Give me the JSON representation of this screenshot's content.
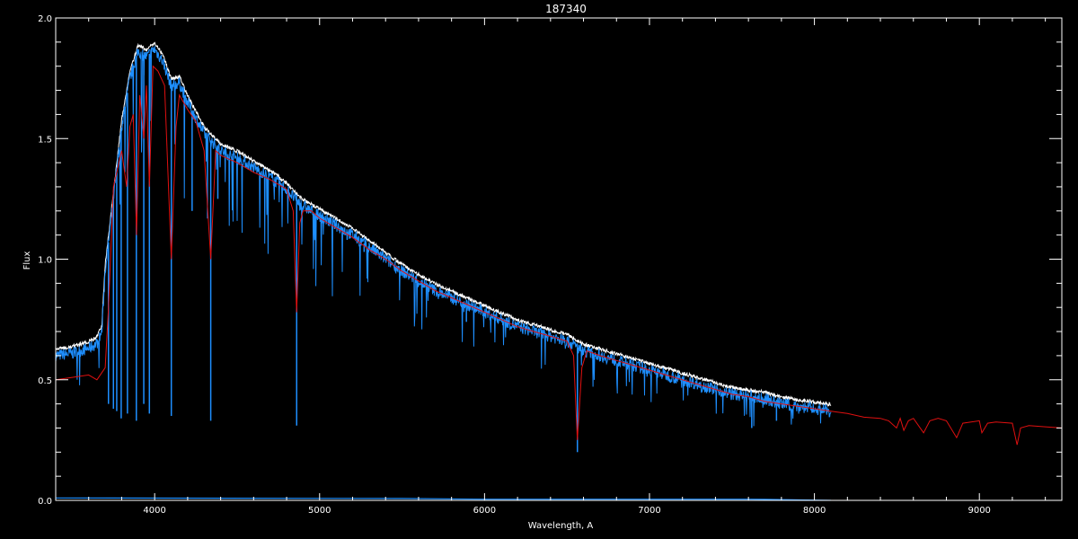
{
  "chart_data": {
    "type": "line",
    "title": "187340",
    "xlabel": "Wavelength, A",
    "ylabel": "Flux",
    "xlim": [
      3400,
      9500
    ],
    "ylim": [
      0.0,
      2.0
    ],
    "xticks": [
      4000,
      5000,
      6000,
      7000,
      8000,
      9000
    ],
    "yticks": [
      0.0,
      0.5,
      1.0,
      1.5,
      2.0
    ],
    "ytick_labels": [
      "0.0",
      "0.5",
      "1.0",
      "1.5",
      "2.0"
    ],
    "grid": false,
    "colors": {
      "background": "#000000",
      "axes": "#ffffff",
      "model": "#e01010",
      "observed": "#1e8fff",
      "observed_upper": "#ffffff"
    },
    "series": [
      {
        "color": "#1e8fff",
        "style": "observed-noisy",
        "x": [
          3400,
          3500,
          3600,
          3650,
          3680,
          3700,
          3750,
          3800,
          3850,
          3900,
          3950,
          4000,
          4050,
          4100,
          4150,
          4200,
          4300,
          4400,
          4500,
          4600,
          4700,
          4800,
          4850,
          4900,
          5000,
          5100,
          5200,
          5300,
          5400,
          5500,
          5600,
          5700,
          5800,
          5900,
          6000,
          6100,
          6200,
          6300,
          6400,
          6500,
          6600,
          6700,
          6800,
          6900,
          7000,
          7100,
          7200,
          7300,
          7400,
          7500,
          7600,
          7700,
          7800,
          7900,
          8000,
          8100
        ],
        "y": [
          0.6,
          0.61,
          0.63,
          0.65,
          0.7,
          0.95,
          1.25,
          1.55,
          1.75,
          1.86,
          1.84,
          1.87,
          1.82,
          1.72,
          1.73,
          1.65,
          1.52,
          1.45,
          1.42,
          1.38,
          1.34,
          1.29,
          1.25,
          1.22,
          1.18,
          1.14,
          1.1,
          1.05,
          1.0,
          0.95,
          0.91,
          0.87,
          0.84,
          0.81,
          0.78,
          0.75,
          0.72,
          0.7,
          0.68,
          0.66,
          0.62,
          0.6,
          0.58,
          0.56,
          0.54,
          0.52,
          0.5,
          0.48,
          0.46,
          0.44,
          0.43,
          0.42,
          0.4,
          0.39,
          0.38,
          0.37
        ],
        "lines": [
          {
            "x": 3720,
            "y": 0.4
          },
          {
            "x": 3750,
            "y": 0.38
          },
          {
            "x": 3770,
            "y": 0.37
          },
          {
            "x": 3797,
            "y": 0.34
          },
          {
            "x": 3835,
            "y": 0.36
          },
          {
            "x": 3889,
            "y": 0.33
          },
          {
            "x": 3934,
            "y": 0.4
          },
          {
            "x": 3968,
            "y": 0.36
          },
          {
            "x": 4101,
            "y": 0.35
          },
          {
            "x": 4227,
            "y": 1.2
          },
          {
            "x": 4340,
            "y": 0.33
          },
          {
            "x": 4383,
            "y": 1.25
          },
          {
            "x": 4861,
            "y": 0.31
          },
          {
            "x": 5167,
            "y": 1.08
          },
          {
            "x": 5270,
            "y": 1.03
          },
          {
            "x": 5890,
            "y": 0.74
          },
          {
            "x": 6563,
            "y": 0.2
          },
          {
            "x": 7620,
            "y": 0.3
          },
          {
            "x": 7770,
            "y": 0.33
          }
        ]
      },
      {
        "color": "#1e8fff",
        "style": "error",
        "x": [
          3400,
          5500,
          6000,
          7600,
          7700,
          8100
        ],
        "y": [
          0.01,
          0.008,
          0.005,
          0.005,
          0.004,
          0.0
        ]
      },
      {
        "color": "#e01010",
        "style": "model",
        "x": [
          3400,
          3500,
          3600,
          3650,
          3700,
          3720,
          3750,
          3800,
          3830,
          3850,
          3870,
          3890,
          3910,
          3935,
          3950,
          3968,
          3990,
          4020,
          4060,
          4101,
          4130,
          4150,
          4200,
          4250,
          4300,
          4340,
          4370,
          4400,
          4500,
          4600,
          4700,
          4800,
          4840,
          4861,
          4880,
          4900,
          4950,
          5000,
          5100,
          5200,
          5300,
          5400,
          5500,
          5600,
          5700,
          5800,
          5900,
          6000,
          6100,
          6200,
          6300,
          6400,
          6500,
          6540,
          6563,
          6590,
          6620,
          6700,
          6800,
          6900,
          7000,
          7100,
          7200,
          7300,
          7400,
          7500,
          7600,
          7700,
          7800,
          7900,
          8000,
          8100,
          8200,
          8300,
          8400,
          8450,
          8498,
          8520,
          8542,
          8570,
          8600,
          8662,
          8700,
          8750,
          8800,
          8862,
          8900,
          9000,
          9015,
          9050,
          9100,
          9200,
          9229,
          9250,
          9300,
          9400,
          9500
        ],
        "y": [
          0.5,
          0.51,
          0.52,
          0.5,
          0.55,
          0.8,
          1.3,
          1.45,
          1.3,
          1.55,
          1.6,
          1.1,
          1.68,
          1.5,
          1.72,
          1.3,
          1.8,
          1.78,
          1.72,
          1.0,
          1.55,
          1.68,
          1.62,
          1.57,
          1.45,
          1.0,
          1.45,
          1.43,
          1.4,
          1.36,
          1.33,
          1.29,
          1.2,
          0.78,
          1.15,
          1.2,
          1.2,
          1.17,
          1.13,
          1.09,
          1.04,
          1.0,
          0.95,
          0.91,
          0.87,
          0.84,
          0.81,
          0.78,
          0.75,
          0.72,
          0.7,
          0.68,
          0.66,
          0.6,
          0.25,
          0.55,
          0.62,
          0.6,
          0.58,
          0.56,
          0.54,
          0.52,
          0.5,
          0.48,
          0.46,
          0.44,
          0.43,
          0.41,
          0.4,
          0.39,
          0.38,
          0.37,
          0.36,
          0.345,
          0.34,
          0.33,
          0.3,
          0.34,
          0.29,
          0.33,
          0.34,
          0.28,
          0.33,
          0.34,
          0.33,
          0.26,
          0.32,
          0.33,
          0.28,
          0.32,
          0.325,
          0.32,
          0.23,
          0.3,
          0.31,
          0.305,
          0.3
        ]
      }
    ]
  }
}
